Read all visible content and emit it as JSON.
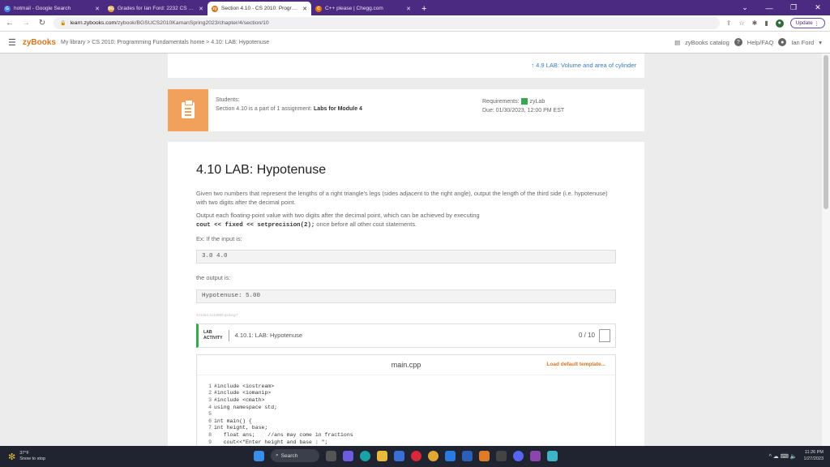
{
  "tabs": [
    {
      "label": "hotmail - Google Search",
      "fav": "G",
      "color": "#4285f4",
      "active": false
    },
    {
      "label": "Grades for Ian Ford: 2232 CS 2010",
      "fav": "BG",
      "color": "#e8a23a",
      "active": false
    },
    {
      "label": "Section 4.10 - CS 2010: Programm",
      "fav": "zy",
      "color": "#d9741f",
      "active": true
    },
    {
      "label": "C++ please | Chegg.com",
      "fav": "C",
      "color": "#eb7100",
      "active": false
    }
  ],
  "address": {
    "host": "learn.zybooks.com",
    "path": "/zybook/BGSUCS2010KamanSpring2023/chapter/4/section/10"
  },
  "update_label": "Update",
  "header": {
    "logo": "zyBooks",
    "breadcrumb": "My library > CS 2010: Programming Fundamentals home > 4.10: LAB: Hypotenuse",
    "catalog": "zyBooks catalog",
    "help": "Help/FAQ",
    "user": "Ian Ford"
  },
  "prev_section": "↑ 4.9 LAB: Volume and area of cylinder",
  "assignment": {
    "students_label": "Students:",
    "text_prefix": "Section 4.10 is a part of 1 assignment:",
    "assignment_name": "Labs for Module 4",
    "requirements_label": "Requirements:",
    "requirement": "zyLab",
    "due": "Due: 01/30/2023, 12:00 PM EST"
  },
  "content": {
    "title": "4.10 LAB: Hypotenuse",
    "p1": "Given two numbers that represent the lengths of a right triangle's legs (sides adjacent to the right angle), output the length of the third side (i.e. hypotenuse) with two digits after the decimal point.",
    "p2": "Output each floating-point value with two digits after the decimal point, which can be achieved by executing",
    "code_inline": "cout << fixed << setprecision(2);",
    "p2_suffix": " once before all other cout statements.",
    "ex_label": "Ex: If the input is:",
    "example_input": "3.0 4.0",
    "output_label": "the output is:",
    "example_output": "Hypotenuse: 5.00",
    "meta": "441454.3114980.qx3zqy7"
  },
  "lab": {
    "tag_line1": "LAB",
    "tag_line2": "ACTIVITY",
    "title": "4.10.1: LAB: Hypotenuse",
    "score": "0 / 10",
    "filename": "main.cpp",
    "load_template": "Load default template..."
  },
  "code_lines": [
    {
      "n": "1",
      "text": "#include <iostream>"
    },
    {
      "n": "2",
      "text": "#include <iomanip>"
    },
    {
      "n": "3",
      "text": "#include <cmath>"
    },
    {
      "n": "4",
      "text": "using namespace std;"
    },
    {
      "n": "5",
      "text": ""
    },
    {
      "n": "6",
      "text": "int main() {"
    },
    {
      "n": "7",
      "text": "int height, base;"
    },
    {
      "n": "8",
      "text": "   float ans;    //ans may come in fractions"
    },
    {
      "n": "9",
      "text": "   cout<<\"Enter height and base : \";"
    }
  ],
  "taskbar": {
    "temp": "37°F",
    "weather": "Snow to stop",
    "search": "Search",
    "time": "11:26 PM",
    "date": "1/27/2023"
  }
}
